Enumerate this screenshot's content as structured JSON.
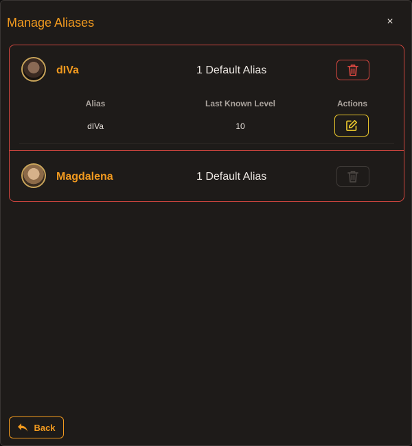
{
  "dialog": {
    "title": "Manage Aliases",
    "close_label": "×"
  },
  "characters": [
    {
      "name": "dIVa",
      "alias_count": "1 Default Alias",
      "delete_enabled": true
    },
    {
      "name": "Magdalena",
      "alias_count": "1 Default Alias",
      "delete_enabled": false
    }
  ],
  "alias_table": {
    "headers": [
      "Alias",
      "Last Known Level",
      "Actions"
    ],
    "rows": [
      {
        "alias": "dIVa",
        "level": "10"
      }
    ]
  },
  "footer": {
    "back_label": "Back"
  },
  "colors": {
    "accent": "#f29a1f",
    "danger": "#d2463f",
    "edit": "#e8c52c",
    "background": "#1e1b19"
  }
}
